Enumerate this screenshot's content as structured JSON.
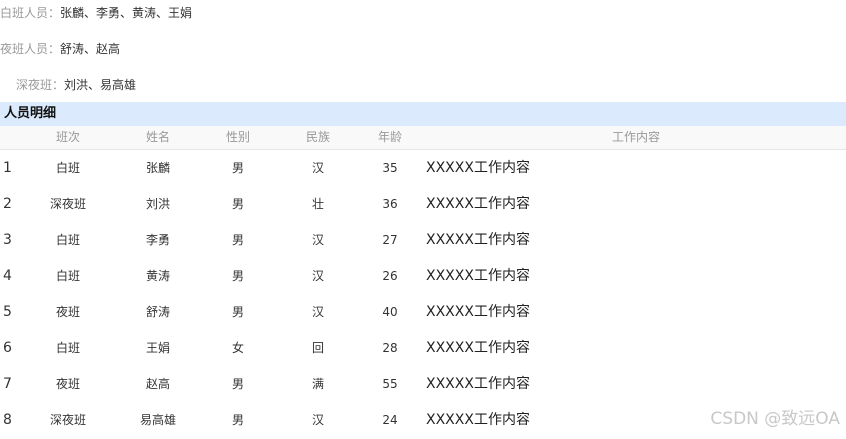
{
  "shifts": {
    "day": {
      "label": "白班人员：",
      "members": "张麟、李勇、黄涛、王娟"
    },
    "night": {
      "label": "夜班人员：",
      "members": "舒涛、赵高"
    },
    "late_night": {
      "label": "深夜班：",
      "members": "刘洪、易高雄"
    }
  },
  "section_title": "人员明细",
  "table": {
    "headers": {
      "shift": "班次",
      "name": "姓名",
      "sex": "性别",
      "ethnicity": "民族",
      "age": "年龄",
      "work": "工作内容"
    },
    "rows": [
      {
        "idx": "1",
        "shift": "白班",
        "name": "张麟",
        "sex": "男",
        "ethnicity": "汉",
        "age": "35",
        "work": "XXXXX工作内容"
      },
      {
        "idx": "2",
        "shift": "深夜班",
        "name": "刘洪",
        "sex": "男",
        "ethnicity": "壮",
        "age": "36",
        "work": "XXXXX工作内容"
      },
      {
        "idx": "3",
        "shift": "白班",
        "name": "李勇",
        "sex": "男",
        "ethnicity": "汉",
        "age": "27",
        "work": "XXXXX工作内容"
      },
      {
        "idx": "4",
        "shift": "白班",
        "name": "黄涛",
        "sex": "男",
        "ethnicity": "汉",
        "age": "26",
        "work": "XXXXX工作内容"
      },
      {
        "idx": "5",
        "shift": "夜班",
        "name": "舒涛",
        "sex": "男",
        "ethnicity": "汉",
        "age": "40",
        "work": "XXXXX工作内容"
      },
      {
        "idx": "6",
        "shift": "白班",
        "name": "王娟",
        "sex": "女",
        "ethnicity": "回",
        "age": "28",
        "work": "XXXXX工作内容"
      },
      {
        "idx": "7",
        "shift": "夜班",
        "name": "赵高",
        "sex": "男",
        "ethnicity": "满",
        "age": "55",
        "work": "XXXXX工作内容"
      },
      {
        "idx": "8",
        "shift": "深夜班",
        "name": "易高雄",
        "sex": "男",
        "ethnicity": "汉",
        "age": "24",
        "work": "XXXXX工作内容"
      }
    ]
  },
  "watermark": "CSDN @致远OA",
  "colors": {
    "section_header_bg": "#dbeafc",
    "label_gray": "#999999",
    "text": "#333333"
  }
}
